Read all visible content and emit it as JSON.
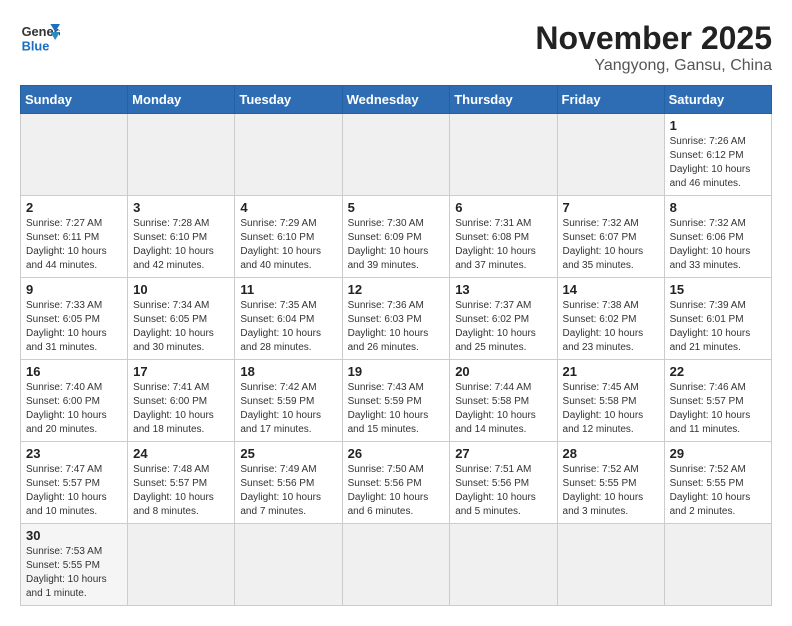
{
  "header": {
    "logo_general": "General",
    "logo_blue": "Blue",
    "month_title": "November 2025",
    "location": "Yangyong, Gansu, China"
  },
  "weekdays": [
    "Sunday",
    "Monday",
    "Tuesday",
    "Wednesday",
    "Thursday",
    "Friday",
    "Saturday"
  ],
  "days": [
    {
      "day": "",
      "info": "",
      "empty": true
    },
    {
      "day": "",
      "info": "",
      "empty": true
    },
    {
      "day": "",
      "info": "",
      "empty": true
    },
    {
      "day": "",
      "info": "",
      "empty": true
    },
    {
      "day": "",
      "info": "",
      "empty": true
    },
    {
      "day": "",
      "info": "",
      "empty": true
    },
    {
      "day": "1",
      "info": "Sunrise: 7:26 AM\nSunset: 6:12 PM\nDaylight: 10 hours and 46 minutes.",
      "empty": false
    },
    {
      "day": "2",
      "info": "Sunrise: 7:27 AM\nSunset: 6:11 PM\nDaylight: 10 hours and 44 minutes.",
      "empty": false
    },
    {
      "day": "3",
      "info": "Sunrise: 7:28 AM\nSunset: 6:10 PM\nDaylight: 10 hours and 42 minutes.",
      "empty": false
    },
    {
      "day": "4",
      "info": "Sunrise: 7:29 AM\nSunset: 6:10 PM\nDaylight: 10 hours and 40 minutes.",
      "empty": false
    },
    {
      "day": "5",
      "info": "Sunrise: 7:30 AM\nSunset: 6:09 PM\nDaylight: 10 hours and 39 minutes.",
      "empty": false
    },
    {
      "day": "6",
      "info": "Sunrise: 7:31 AM\nSunset: 6:08 PM\nDaylight: 10 hours and 37 minutes.",
      "empty": false
    },
    {
      "day": "7",
      "info": "Sunrise: 7:32 AM\nSunset: 6:07 PM\nDaylight: 10 hours and 35 minutes.",
      "empty": false
    },
    {
      "day": "8",
      "info": "Sunrise: 7:32 AM\nSunset: 6:06 PM\nDaylight: 10 hours and 33 minutes.",
      "empty": false
    },
    {
      "day": "9",
      "info": "Sunrise: 7:33 AM\nSunset: 6:05 PM\nDaylight: 10 hours and 31 minutes.",
      "empty": false
    },
    {
      "day": "10",
      "info": "Sunrise: 7:34 AM\nSunset: 6:05 PM\nDaylight: 10 hours and 30 minutes.",
      "empty": false
    },
    {
      "day": "11",
      "info": "Sunrise: 7:35 AM\nSunset: 6:04 PM\nDaylight: 10 hours and 28 minutes.",
      "empty": false
    },
    {
      "day": "12",
      "info": "Sunrise: 7:36 AM\nSunset: 6:03 PM\nDaylight: 10 hours and 26 minutes.",
      "empty": false
    },
    {
      "day": "13",
      "info": "Sunrise: 7:37 AM\nSunset: 6:02 PM\nDaylight: 10 hours and 25 minutes.",
      "empty": false
    },
    {
      "day": "14",
      "info": "Sunrise: 7:38 AM\nSunset: 6:02 PM\nDaylight: 10 hours and 23 minutes.",
      "empty": false
    },
    {
      "day": "15",
      "info": "Sunrise: 7:39 AM\nSunset: 6:01 PM\nDaylight: 10 hours and 21 minutes.",
      "empty": false
    },
    {
      "day": "16",
      "info": "Sunrise: 7:40 AM\nSunset: 6:00 PM\nDaylight: 10 hours and 20 minutes.",
      "empty": false
    },
    {
      "day": "17",
      "info": "Sunrise: 7:41 AM\nSunset: 6:00 PM\nDaylight: 10 hours and 18 minutes.",
      "empty": false
    },
    {
      "day": "18",
      "info": "Sunrise: 7:42 AM\nSunset: 5:59 PM\nDaylight: 10 hours and 17 minutes.",
      "empty": false
    },
    {
      "day": "19",
      "info": "Sunrise: 7:43 AM\nSunset: 5:59 PM\nDaylight: 10 hours and 15 minutes.",
      "empty": false
    },
    {
      "day": "20",
      "info": "Sunrise: 7:44 AM\nSunset: 5:58 PM\nDaylight: 10 hours and 14 minutes.",
      "empty": false
    },
    {
      "day": "21",
      "info": "Sunrise: 7:45 AM\nSunset: 5:58 PM\nDaylight: 10 hours and 12 minutes.",
      "empty": false
    },
    {
      "day": "22",
      "info": "Sunrise: 7:46 AM\nSunset: 5:57 PM\nDaylight: 10 hours and 11 minutes.",
      "empty": false
    },
    {
      "day": "23",
      "info": "Sunrise: 7:47 AM\nSunset: 5:57 PM\nDaylight: 10 hours and 10 minutes.",
      "empty": false
    },
    {
      "day": "24",
      "info": "Sunrise: 7:48 AM\nSunset: 5:57 PM\nDaylight: 10 hours and 8 minutes.",
      "empty": false
    },
    {
      "day": "25",
      "info": "Sunrise: 7:49 AM\nSunset: 5:56 PM\nDaylight: 10 hours and 7 minutes.",
      "empty": false
    },
    {
      "day": "26",
      "info": "Sunrise: 7:50 AM\nSunset: 5:56 PM\nDaylight: 10 hours and 6 minutes.",
      "empty": false
    },
    {
      "day": "27",
      "info": "Sunrise: 7:51 AM\nSunset: 5:56 PM\nDaylight: 10 hours and 5 minutes.",
      "empty": false
    },
    {
      "day": "28",
      "info": "Sunrise: 7:52 AM\nSunset: 5:55 PM\nDaylight: 10 hours and 3 minutes.",
      "empty": false
    },
    {
      "day": "29",
      "info": "Sunrise: 7:52 AM\nSunset: 5:55 PM\nDaylight: 10 hours and 2 minutes.",
      "empty": false
    },
    {
      "day": "30",
      "info": "Sunrise: 7:53 AM\nSunset: 5:55 PM\nDaylight: 10 hours and 1 minute.",
      "empty": false
    },
    {
      "day": "",
      "info": "",
      "empty": true
    },
    {
      "day": "",
      "info": "",
      "empty": true
    },
    {
      "day": "",
      "info": "",
      "empty": true
    },
    {
      "day": "",
      "info": "",
      "empty": true
    },
    {
      "day": "",
      "info": "",
      "empty": true
    },
    {
      "day": "",
      "info": "",
      "empty": true
    }
  ]
}
